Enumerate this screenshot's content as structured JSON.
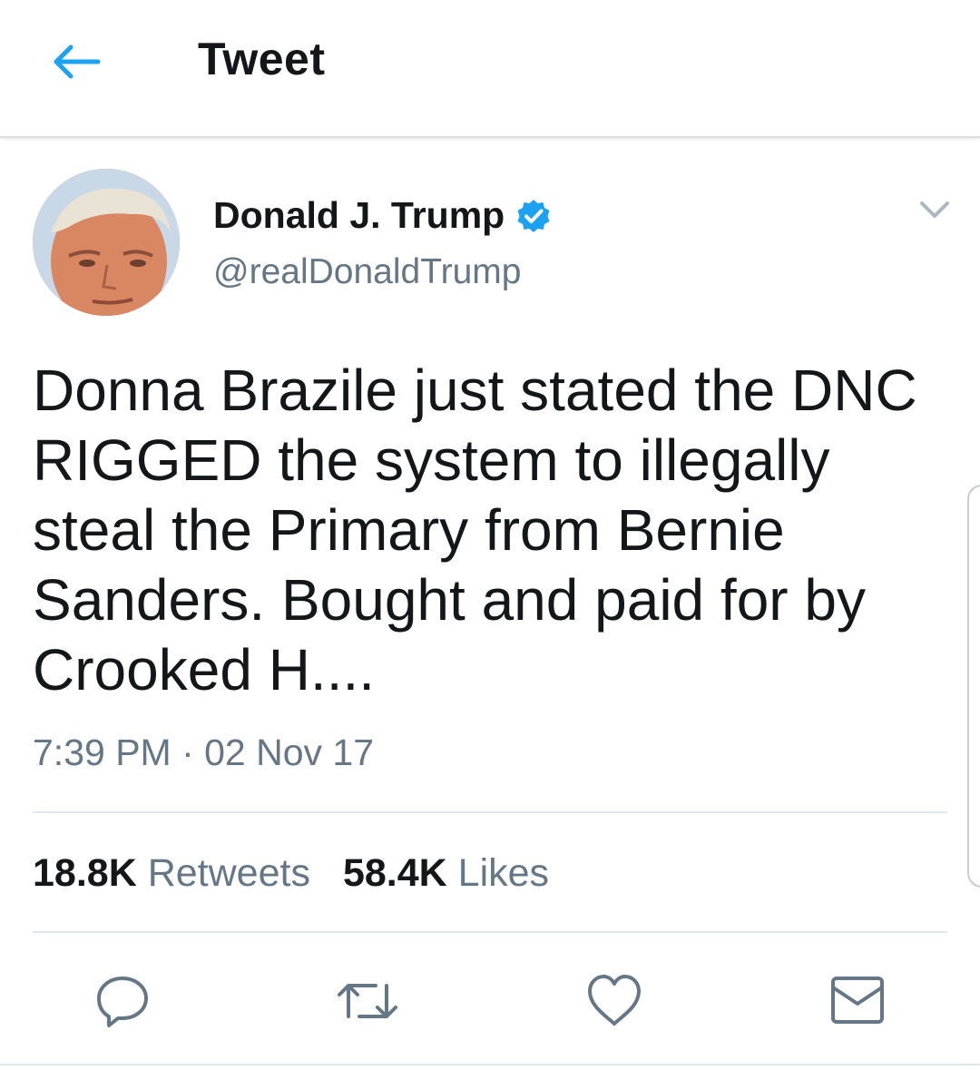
{
  "appbar": {
    "title": "Tweet",
    "back_icon": "arrow-left-icon"
  },
  "colors": {
    "accent": "#1da1f2",
    "text": "#14171a",
    "secondary": "#657786",
    "divider": "#e1e8ed"
  },
  "tweet": {
    "author_name": "Donald J. Trump",
    "handle": "@realDonaldTrump",
    "verified": true,
    "text": "Donna Brazile just stated the DNC RIGGED the system to illegally steal the Primary from Bernie Sanders. Bought and paid for by Crooked H....",
    "timestamp": "7:39 PM · 02 Nov 17",
    "retweets_count": "18.8K",
    "retweets_label": "Retweets",
    "likes_count": "58.4K",
    "likes_label": "Likes"
  },
  "actions": [
    "reply-icon",
    "retweet-icon",
    "like-icon",
    "message-icon"
  ]
}
